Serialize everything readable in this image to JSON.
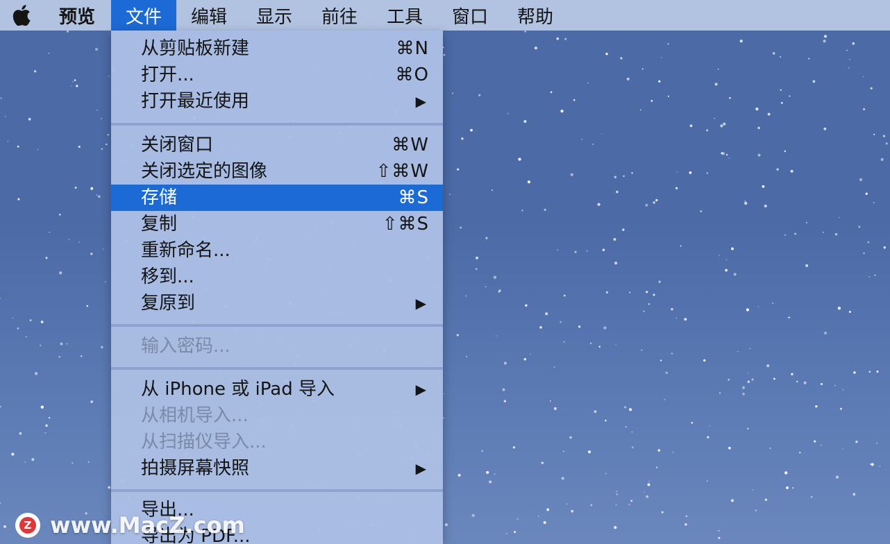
{
  "menubar": {
    "apple_icon": "apple-logo-icon",
    "items": [
      {
        "label": "预览"
      },
      {
        "label": "文件"
      },
      {
        "label": "编辑"
      },
      {
        "label": "显示"
      },
      {
        "label": "前往"
      },
      {
        "label": "工具"
      },
      {
        "label": "窗口"
      },
      {
        "label": "帮助"
      }
    ],
    "active_item": "文件"
  },
  "file_menu": {
    "items": [
      {
        "label": "从剪贴板新建",
        "shortcut": "⌘N"
      },
      {
        "label": "打开...",
        "shortcut": "⌘O"
      },
      {
        "label": "打开最近使用",
        "arrow": "▶"
      },
      {
        "label": "关闭窗口",
        "shortcut": "⌘W"
      },
      {
        "label": "关闭选定的图像",
        "shortcut": "⇧⌘W"
      },
      {
        "label": "存储",
        "shortcut": "⌘S",
        "state": "highlighted"
      },
      {
        "label": "复制",
        "shortcut": "⇧⌘S"
      },
      {
        "label": "重新命名..."
      },
      {
        "label": "移到..."
      },
      {
        "label": "复原到",
        "arrow": "▶"
      },
      {
        "label": "输入密码...",
        "state": "disabled"
      },
      {
        "label": "从 iPhone 或 iPad 导入",
        "arrow": "▶"
      },
      {
        "label": "从相机导入...",
        "state": "disabled"
      },
      {
        "label": "从扫描仪导入...",
        "state": "disabled"
      },
      {
        "label": "拍摄屏幕快照",
        "arrow": "▶"
      },
      {
        "label": "导出..."
      },
      {
        "label": "导出为 PDF..."
      }
    ]
  },
  "watermark": {
    "logo_letter": "Z",
    "text": "www.MacZ.com"
  },
  "colors": {
    "highlight": "#1c6ad6",
    "desktop": "#4b6aa6",
    "menu_bg": "#acbee4"
  }
}
